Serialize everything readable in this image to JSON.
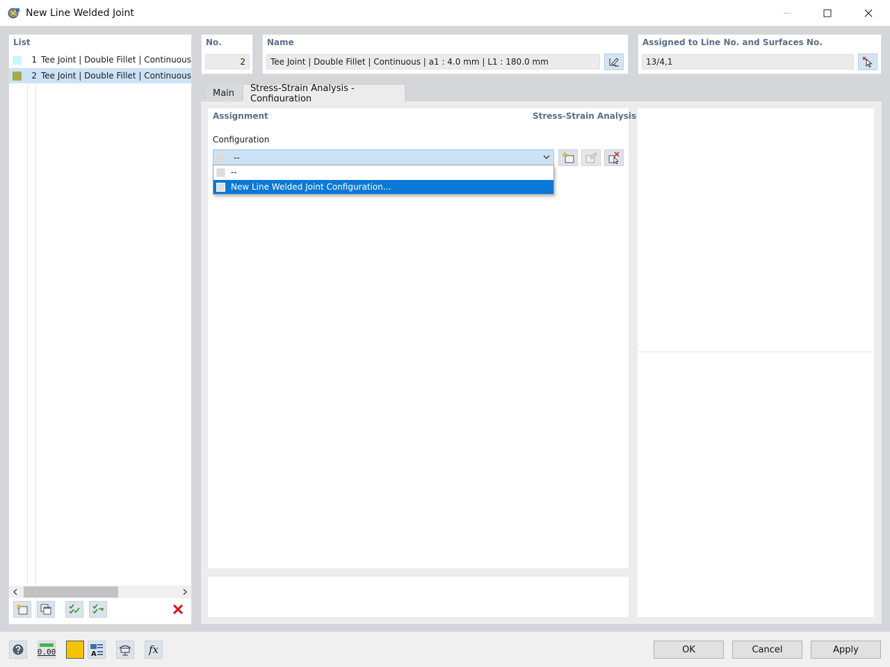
{
  "window": {
    "title": "New Line Welded Joint",
    "icons": {
      "app": "welded-joint-app-icon",
      "minimize": "minimize-icon",
      "maximize": "maximize-icon",
      "close": "close-icon"
    }
  },
  "list": {
    "header": "List",
    "items": [
      {
        "no": "1",
        "label": "Tee Joint | Double Fillet | Continuous |",
        "color": "#ccf5ff",
        "selected": false
      },
      {
        "no": "2",
        "label": "Tee Joint | Double Fillet | Continuous |",
        "color": "#a9a84a",
        "selected": true
      }
    ],
    "toolbar": [
      "new-item-icon",
      "copy-item-icon",
      "check-all-icon",
      "check-renumber-icon",
      "delete-icon"
    ]
  },
  "number": {
    "header": "No.",
    "value": "2"
  },
  "name": {
    "header": "Name",
    "value": "Tee Joint | Double Fillet | Continuous | a1 : 4.0 mm | L1 : 180.0 mm",
    "edit_icon": "edit-name-icon"
  },
  "assigned": {
    "header": "Assigned to Line No. and Surfaces No.",
    "value": "13/4,1",
    "pick_icon": "pick-objects-icon"
  },
  "tabs": [
    {
      "label": "Main",
      "active": false
    },
    {
      "label": "Stress-Strain Analysis - Configuration",
      "active": true
    }
  ],
  "assignment": {
    "header": "Assignment",
    "right_header": "Stress-Strain Analysis",
    "configuration_label": "Configuration",
    "selected_value": "--",
    "options": [
      {
        "label": "--",
        "highlighted": false
      },
      {
        "label": "New Line Welded Joint Configuration...",
        "highlighted": true
      }
    ],
    "buttons": [
      "new-configuration-icon",
      "edit-configuration-icon",
      "delete-configuration-icon"
    ]
  },
  "bottom_icons": [
    "help-icon",
    "units-icon",
    "color-icon",
    "display-icon",
    "view-icon",
    "formula-icon"
  ],
  "bottom_icon_texts": {
    "units": "0.00",
    "formula": "fx"
  },
  "dialog_buttons": {
    "ok": "OK",
    "cancel": "Cancel",
    "apply": "Apply"
  },
  "colors": {
    "accent": "#0a78d7",
    "header_text": "#5a6f8a",
    "selection": "#cce3f7",
    "color_swatch": "#f5c400"
  }
}
